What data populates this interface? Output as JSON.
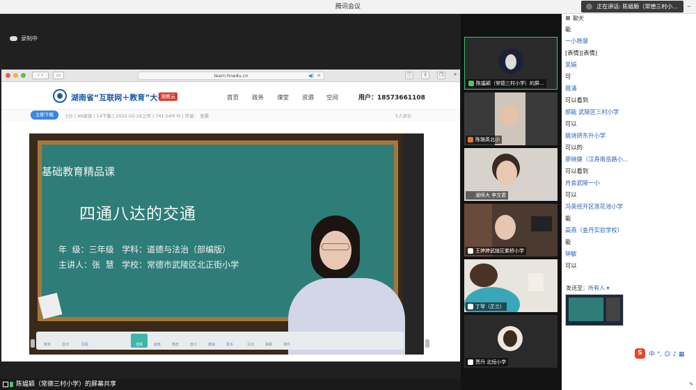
{
  "window": {
    "title": "腾讯会议",
    "minimize": "–"
  },
  "speaking": {
    "label": "正在讲话: 陈媪颖（常德三村小..."
  },
  "recording": {
    "label": "录制中"
  },
  "browser": {
    "url": "learn.hnedu.cn",
    "site_name": "湖南省“互联网＋教育”大平台",
    "site_badge": "湘教云",
    "nav": [
      "首页",
      "政务",
      "课堂",
      "资源",
      "空间"
    ],
    "user_label": "用户：18573661108",
    "download": "立即下载",
    "meta": "5分 | 96阅读 | 14下载 | 2022-02-18上传 | 741.54M M | 作者： 张慧",
    "rating": "5人评价"
  },
  "slide": {
    "course": "基础教育精品课",
    "title": "四通八达的交通",
    "line1": "年  级：三年级   学科：道德与法治（部编版）",
    "line2": "主讲人：张  慧   学校：常德市武陵区北正街小学",
    "tools": [
      "菜单",
      "显示",
      "回看",
      "选择",
      "画笔",
      "橡皮",
      "放大",
      "撤销",
      "更多",
      "互动",
      "弹幕",
      "课件"
    ]
  },
  "share_bar": {
    "label": "陈媪颖（常德三村小学）的屏幕共享"
  },
  "participants": [
    {
      "name": "陈媪颖（常德三村小学）的屏..."
    },
    {
      "name": "陈璐英北小"
    },
    {
      "name": "湖师大 李文君"
    },
    {
      "name": "王婷婷武陵区紫桥小学"
    },
    {
      "name": "丁琴（芷兰）"
    },
    {
      "name": "贾丹 北恒小学"
    }
  ],
  "chat": {
    "title": "聊天",
    "messages": [
      {
        "type": "text",
        "v": "能"
      },
      {
        "type": "name",
        "v": "一小杨慧"
      },
      {
        "type": "text",
        "v": "[表情][表情]"
      },
      {
        "type": "name",
        "v": "吴娟"
      },
      {
        "type": "text",
        "v": "可"
      },
      {
        "type": "name",
        "v": "聂涌"
      },
      {
        "type": "text",
        "v": "可以看到"
      },
      {
        "type": "name",
        "v": "郝能 武陵区三村小学"
      },
      {
        "type": "text",
        "v": "可以"
      },
      {
        "type": "name",
        "v": "姚诗妍东升小学"
      },
      {
        "type": "text",
        "v": "可以的"
      },
      {
        "type": "name",
        "v": "廖晓婕（汉寿南岳路小..."
      },
      {
        "type": "text",
        "v": "可以看到"
      },
      {
        "type": "name",
        "v": "肖会武陵一小"
      },
      {
        "type": "text",
        "v": "可以"
      },
      {
        "type": "name",
        "v": "冯英经开区莲花池小学"
      },
      {
        "type": "text",
        "v": "能"
      },
      {
        "type": "name",
        "v": "高燕（金丹实验学校）"
      },
      {
        "type": "text",
        "v": "能"
      },
      {
        "type": "name",
        "v": "钟敏"
      },
      {
        "type": "text",
        "v": "可以"
      }
    ],
    "send_to_label": "发送至：",
    "send_to_value": "所有人 ▾"
  },
  "ime": {
    "s": "S",
    "text": "中 °, ☺ ♪ ▦"
  },
  "colors": {
    "accent": "#2a63b8",
    "active_green": "#3ec36a",
    "board": "#2f7d78"
  }
}
